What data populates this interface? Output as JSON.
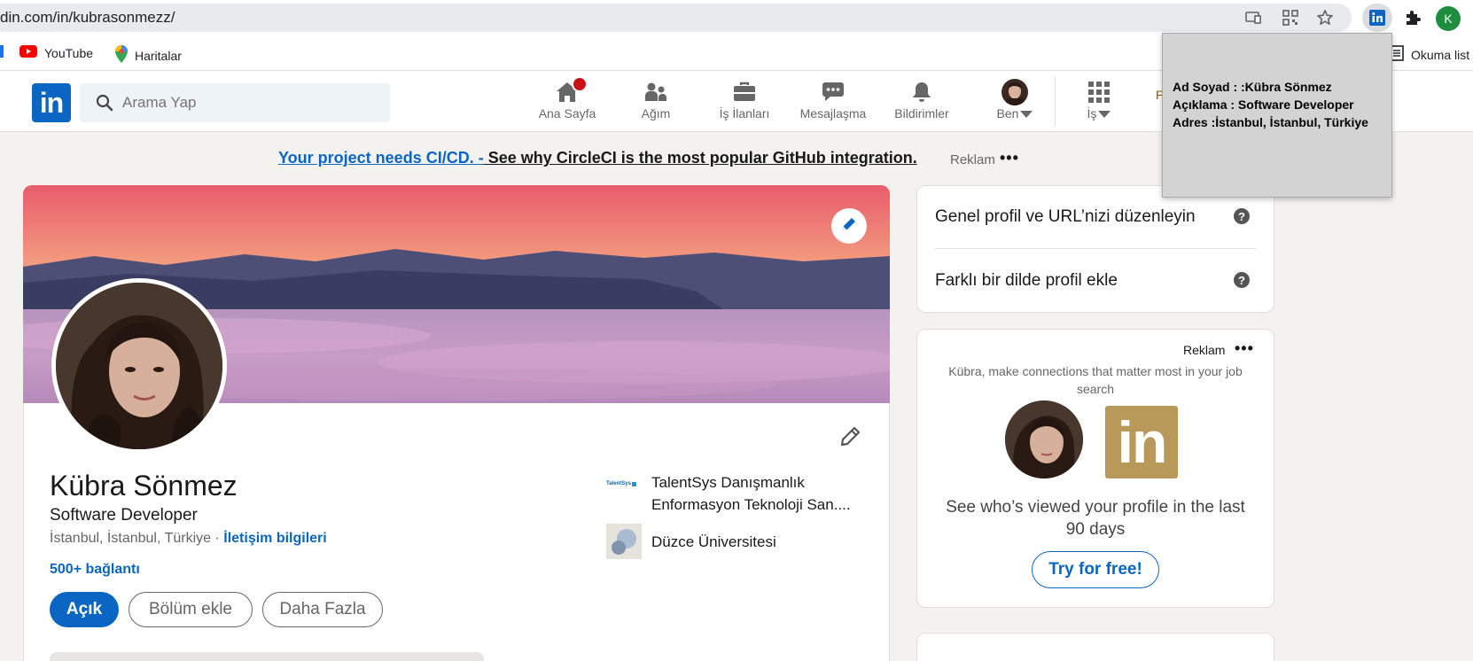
{
  "browser": {
    "url": "din.com/in/kubrasonmezz/",
    "profile_initial": "K",
    "bookmarks": [
      {
        "label": "YouTube",
        "icon": "youtube-icon"
      },
      {
        "label": "Haritalar",
        "icon": "maps-pin-icon"
      }
    ],
    "reading_list_label": "Okuma list"
  },
  "nav": {
    "search_placeholder": "Arama Yap",
    "items": [
      {
        "label": "Ana Sayfa",
        "icon": "home-icon"
      },
      {
        "label": "Ağım",
        "icon": "network-icon"
      },
      {
        "label": "İş İlanları",
        "icon": "briefcase-icon"
      },
      {
        "label": "Mesajlaşma",
        "icon": "messaging-icon"
      },
      {
        "label": "Bildirimler",
        "icon": "bell-icon"
      },
      {
        "label": "Ben",
        "icon": "avatar"
      },
      {
        "label": "İş",
        "icon": "grid-icon"
      }
    ],
    "premium_peek": "P"
  },
  "ad_banner": {
    "link_text": "Your project needs CI/CD. -",
    "rest_text": " See why CircleCI is the most popular GitHub integration.",
    "ad_label": "Reklam",
    "more": "•••"
  },
  "profile": {
    "name": "Kübra Sönmez",
    "headline": "Software Developer",
    "location": "İstanbul, İstanbul, Türkiye · ",
    "contact_link": "İletişim bilgileri",
    "connections": "500+ bağlantı",
    "buttons": {
      "open": "Açık",
      "add_section": "Bölüm ekle",
      "more": "Daha Fazla"
    },
    "experience": [
      {
        "name_line1": "TalentSys Danışmanlık",
        "name_line2": "Enformasyon Teknoloji San....",
        "logo_text": "TalentSys"
      },
      {
        "name_line1": "Düzce Üniversitesi"
      }
    ]
  },
  "sidebar": {
    "profile_links": [
      {
        "label": "Genel profil ve URL’nizi düzenleyin"
      },
      {
        "label": "Farklı bir dilde profil ekle"
      }
    ],
    "ad": {
      "label": "Reklam",
      "more": "•••",
      "text": "Kübra, make connections that matter most in your job search",
      "logo": "in",
      "cta": "See who’s viewed your profile in the last 90 days",
      "button": "Try for free!"
    }
  },
  "popup": {
    "line1": "Ad Soyad : :Kübra Sönmez",
    "line2": "Açıklama : Software Developer",
    "line3": "Adres :İstanbul, İstanbul, Türkiye"
  },
  "colors": {
    "linkedin_blue": "#0a66c2",
    "page_bg": "#f3f2ef",
    "notification_red": "#cc1016",
    "premium_gold": "#b9995a"
  }
}
